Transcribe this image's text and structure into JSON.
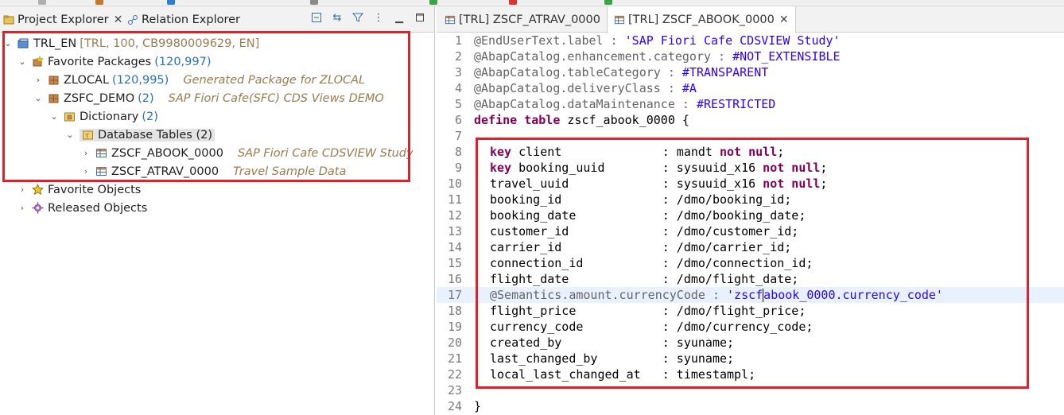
{
  "left": {
    "tabs": {
      "project_explorer": "Project Explorer",
      "relation_explorer": "Relation Explorer"
    },
    "tree": {
      "root": {
        "label": "TRL_EN",
        "meta": "[TRL, 100, CB9980009629, EN]"
      },
      "favorite_packages": {
        "label": "Favorite Packages",
        "count": "(120,997)"
      },
      "zlocal": {
        "label": "ZLOCAL",
        "count": "(120,995)",
        "desc": "Generated Package for ZLOCAL"
      },
      "zsfc_demo": {
        "label": "ZSFC_DEMO",
        "count": "(2)",
        "desc": "SAP Fiori Cafe(SFC) CDS Views DEMO"
      },
      "dictionary": {
        "label": "Dictionary",
        "count": "(2)"
      },
      "database_tables": {
        "label": "Database Tables (2)"
      },
      "abook": {
        "label": "ZSCF_ABOOK_0000",
        "desc": "SAP Fiori Cafe CDSVIEW Study"
      },
      "atrav": {
        "label": "ZSCF_ATRAV_0000",
        "desc": "Travel Sample Data"
      },
      "favorite_objects": {
        "label": "Favorite Objects"
      },
      "released_objects": {
        "label": "Released Objects"
      }
    }
  },
  "editor": {
    "tabs": {
      "atrav": "[TRL] ZSCF_ATRAV_0000",
      "abook": "[TRL] ZSCF_ABOOK_0000"
    },
    "lines": {
      "l1a": "@EndUserText.label : ",
      "l1b": "'SAP Fiori Cafe CDSVIEW Study'",
      "l2a": "@AbapCatalog.enhancement.category : ",
      "l2b": "#NOT_EXTENSIBLE",
      "l3a": "@AbapCatalog.tableCategory : ",
      "l3b": "#TRANSPARENT",
      "l4a": "@AbapCatalog.deliveryClass : ",
      "l4b": "#A",
      "l5a": "@AbapCatalog.dataMaintenance : ",
      "l5b": "#RESTRICTED",
      "l6k1": "define",
      "l6k2": "table",
      "l6t": " zscf_abook_0000 {",
      "l8k": "key",
      "l8t": " client              : mandt ",
      "l8n": "not null",
      "l9k": "key",
      "l9t": " booking_uuid        : sysuuid_x16 ",
      "l9n": "not null",
      "l10t": "travel_uuid             : sysuuid_x16 ",
      "l10n": "not null",
      "l11": "booking_id              : /dmo/booking_id;",
      "l12": "booking_date            : /dmo/booking_date;",
      "l13": "customer_id             : /dmo/customer_id;",
      "l14": "carrier_id              : /dmo/carrier_id;",
      "l15": "connection_id           : /dmo/connection_id;",
      "l16": "flight_date             : /dmo/flight_date;",
      "l17a": "@Semantics.amount.currencyCode : ",
      "l17b": "'zscf",
      "l17c": "abook_0000.currency_code'",
      "l18": "flight_price            : /dmo/flight_price;",
      "l19": "currency_code           : /dmo/currency_code;",
      "l20": "created_by              : syuname;",
      "l21": "last_changed_by         : syuname;",
      "l22": "local_last_changed_at   : timestampl;",
      "l24": "}"
    },
    "line_numbers": [
      "1",
      "2",
      "3",
      "4",
      "5",
      "6",
      "7",
      "8",
      "9",
      "10",
      "11",
      "12",
      "13",
      "14",
      "15",
      "16",
      "17",
      "18",
      "19",
      "20",
      "21",
      "22",
      "23",
      "24"
    ]
  }
}
